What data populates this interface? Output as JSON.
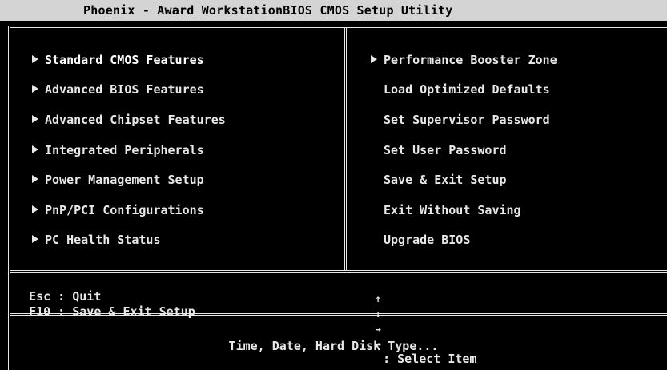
{
  "title": "Phoenix - Award WorkstationBIOS CMOS Setup Utility",
  "left_menu": [
    {
      "label": "Standard CMOS Features",
      "has_submenu": true,
      "selected": true
    },
    {
      "label": "Advanced BIOS Features",
      "has_submenu": true
    },
    {
      "label": "Advanced Chipset Features",
      "has_submenu": true
    },
    {
      "label": "Integrated Peripherals",
      "has_submenu": true
    },
    {
      "label": "Power Management Setup",
      "has_submenu": true
    },
    {
      "label": "PnP/PCI Configurations",
      "has_submenu": true
    },
    {
      "label": "PC Health Status",
      "has_submenu": true
    }
  ],
  "right_menu": [
    {
      "label": "Performance Booster Zone",
      "has_submenu": true
    },
    {
      "label": "Load Optimized Defaults",
      "has_submenu": false
    },
    {
      "label": "Set Supervisor Password",
      "has_submenu": false
    },
    {
      "label": "Set User Password",
      "has_submenu": false
    },
    {
      "label": "Save & Exit Setup",
      "has_submenu": false
    },
    {
      "label": "Exit Without Saving",
      "has_submenu": false
    },
    {
      "label": "Upgrade BIOS",
      "has_submenu": false
    }
  ],
  "help": {
    "esc": "Esc : Quit",
    "f10": "F10 : Save & Exit Setup",
    "arrows": [
      "↑",
      "↓",
      "→",
      "←"
    ],
    "select": ": Select Item"
  },
  "description": "Time, Date, Hard Disk Type...",
  "colors": {
    "background": "#000000",
    "text": "#e8e8e8",
    "title_bar": "#d4d4d4"
  }
}
